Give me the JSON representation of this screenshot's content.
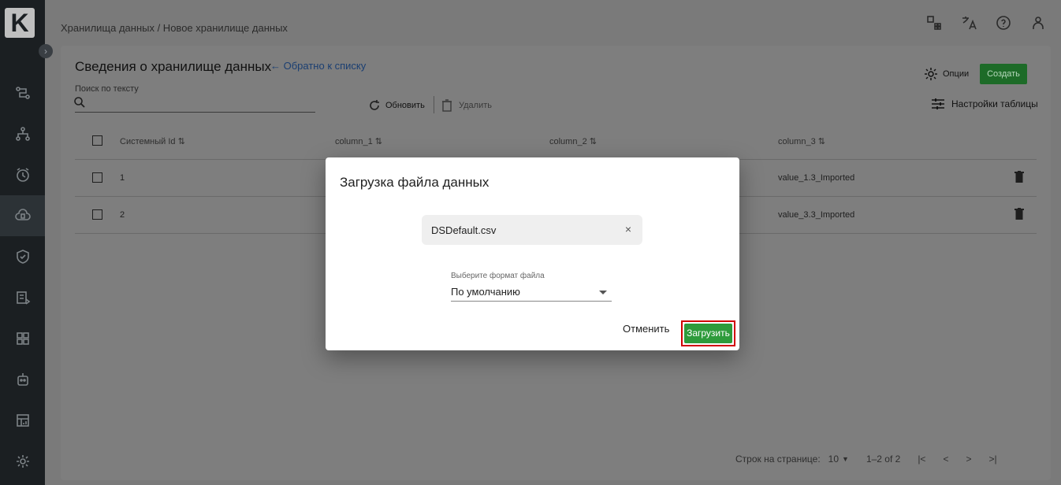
{
  "app": {
    "logo_letter": "K"
  },
  "breadcrumb": "Хранилища данных / Новое хранилище данных",
  "page": {
    "title": "Сведения о хранилище данных",
    "back_link": "← Обратно к списку",
    "search_label": "Поиск по тексту",
    "refresh_label": "Обновить",
    "delete_label": "Удалить",
    "options_label": "Опции",
    "create_label": "Создать",
    "table_settings_label": "Настройки таблицы"
  },
  "table": {
    "columns": [
      "Системный Id ⇅",
      "column_1 ⇅",
      "column_2 ⇅",
      "column_3 ⇅"
    ],
    "rows": [
      {
        "id": "1",
        "c1": "",
        "c2": "",
        "c3": "value_1.3_Imported"
      },
      {
        "id": "2",
        "c1": "",
        "c2": "",
        "c3": "value_3.3_Imported"
      }
    ]
  },
  "pager": {
    "rows_per_page_label": "Строк на странице:",
    "rows_per_page_value": "10",
    "range": "1–2 of 2",
    "first": "|<",
    "prev": "<",
    "next": ">",
    "last": ">|"
  },
  "dialog": {
    "title": "Загрузка файла данных",
    "file_name": "DSDefault.csv",
    "file_close": "×",
    "format_label": "Выберите формат файла",
    "format_value": "По умолчанию",
    "cancel_label": "Отменить",
    "upload_label": "Загрузить"
  },
  "colors": {
    "accent_green": "#2e9b3b",
    "highlight_red": "#d10000",
    "sidebar": "#1b1f22"
  }
}
